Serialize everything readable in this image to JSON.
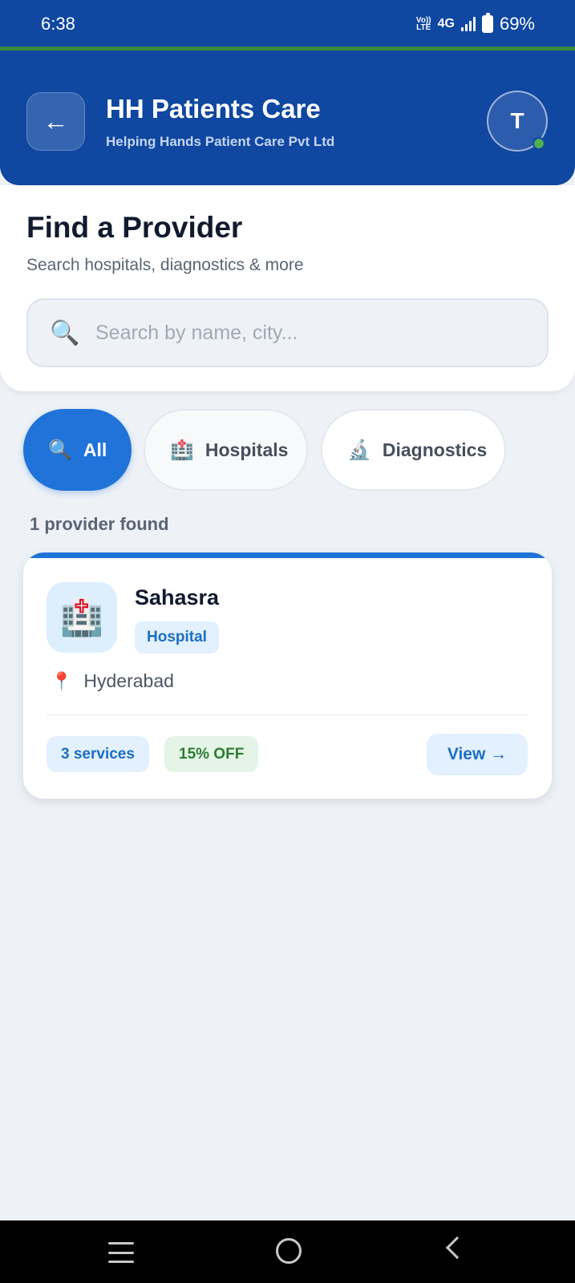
{
  "status_bar": {
    "time": "6:38",
    "volte": "Vo))",
    "volte_sub": "LTE",
    "network": "4G",
    "battery": "69%"
  },
  "header": {
    "back_icon": "←",
    "title": "HH Patients Care",
    "subtitle": "Helping Hands Patient Care Pvt Ltd",
    "avatar_initial": "T"
  },
  "search": {
    "title": "Find a Provider",
    "subtitle": "Search hospitals, diagnostics & more",
    "icon": "🔍",
    "placeholder": "Search by name, city...",
    "value": ""
  },
  "filters": [
    {
      "icon": "🔍",
      "label": "All"
    },
    {
      "icon": "🏥",
      "label": "Hospitals"
    },
    {
      "icon": "🔬",
      "label": "Diagnostics"
    }
  ],
  "results": {
    "count_text": "1 provider found",
    "providers": [
      {
        "icon": "🏥",
        "name": "Sahasra",
        "type": "Hospital",
        "location_icon": "📍",
        "location": "Hyderabad",
        "services": "3 services",
        "offer": "15% OFF",
        "action": "View →"
      }
    ]
  },
  "colors": {
    "primary": "#0f47a1",
    "accent": "#2073d8",
    "background": "#eef2f7",
    "offer_green": "#2e7d32"
  },
  "icons": {
    "back": "arrow-left-icon",
    "search": "magnifier-icon",
    "hospital": "hospital-icon",
    "diagnostics": "microscope-icon",
    "location": "pin-icon"
  }
}
